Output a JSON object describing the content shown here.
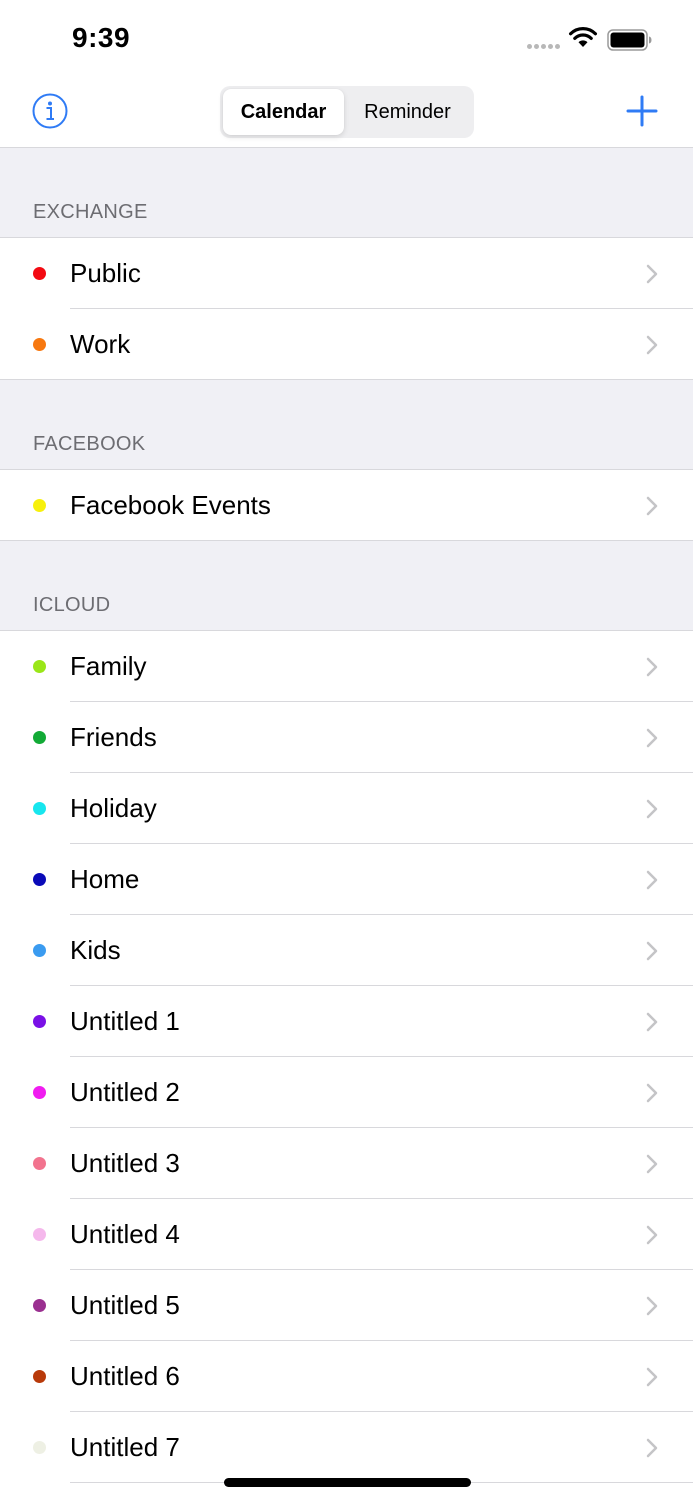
{
  "status_bar": {
    "time": "9:39"
  },
  "nav": {
    "segments": [
      {
        "label": "Calendar",
        "active": true
      },
      {
        "label": "Reminder",
        "active": false
      }
    ],
    "info_icon": "info-circle-icon",
    "add_icon": "plus-icon",
    "accent_color": "#2f7bf5"
  },
  "sections": [
    {
      "header": "EXCHANGE",
      "items": [
        {
          "label": "Public",
          "color": "#f30a12"
        },
        {
          "label": "Work",
          "color": "#f7780f"
        }
      ]
    },
    {
      "header": "FACEBOOK",
      "items": [
        {
          "label": "Facebook Events",
          "color": "#f7f00c"
        }
      ]
    },
    {
      "header": "ICLOUD",
      "items": [
        {
          "label": "Family",
          "color": "#9ae618"
        },
        {
          "label": "Friends",
          "color": "#12aa36"
        },
        {
          "label": "Holiday",
          "color": "#17e6ee"
        },
        {
          "label": "Home",
          "color": "#0a0ab8"
        },
        {
          "label": "Kids",
          "color": "#3a9bf0"
        },
        {
          "label": "Untitled 1",
          "color": "#7a10e6"
        },
        {
          "label": "Untitled 2",
          "color": "#f01cf0"
        },
        {
          "label": "Untitled 3",
          "color": "#f2738e"
        },
        {
          "label": "Untitled 4",
          "color": "#f5b8ec"
        },
        {
          "label": "Untitled 5",
          "color": "#9a3090"
        },
        {
          "label": "Untitled 6",
          "color": "#b83a0a"
        },
        {
          "label": "Untitled 7",
          "color": "#eef0e4"
        }
      ]
    }
  ]
}
